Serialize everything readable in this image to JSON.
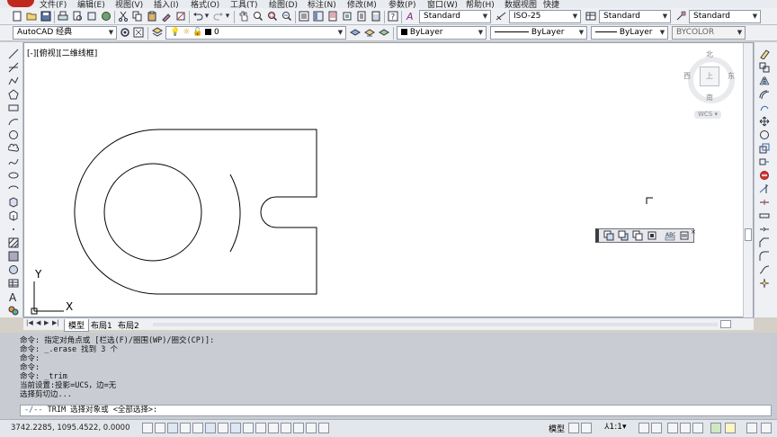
{
  "menu": {
    "items": [
      "文件(F)",
      "编辑(E)",
      "视图(V)",
      "插入(I)",
      "格式(O)",
      "工具(T)",
      "绘图(D)",
      "标注(N)",
      "修改(M)",
      "参数(P)",
      "窗口(W)",
      "帮助(H)",
      "数据视图",
      "快捷"
    ]
  },
  "toolbar": {
    "text_style": "Standard",
    "dim_style": "ISO-25",
    "table_style": "Standard",
    "multileader_style": "Standard",
    "workspace": "AutoCAD 经典",
    "layer": "0",
    "color": "ByLayer",
    "linetype": "ByLayer",
    "lineweight": "ByLayer",
    "plotstyle": "BYCOLOR"
  },
  "viewport": {
    "label": "[-][俯视][二维线框]",
    "viewcube": {
      "north": "北",
      "south": "南",
      "east": "东",
      "west": "西",
      "top": "上",
      "wcs": "WCS"
    },
    "ucs_x": "X",
    "ucs_y": "Y"
  },
  "tabs": {
    "model": "模型",
    "layout1": "布局1",
    "layout2": "布局2"
  },
  "command": {
    "history": [
      "命令: 指定对角点或 [栏选(F)/圈围(WP)/圈交(CP)]:",
      "命令: _.erase 找到 3 个",
      "命令:",
      "命令:",
      "命令: _trim",
      "当前设置:投影=UCS，边=无",
      "选择剪切边..."
    ],
    "prompt": "TRIM 选择对象或 <全部选择>:"
  },
  "status": {
    "coords": "3742.2285, 1095.4522, 0.0000",
    "model_label": "模型",
    "scale": "1:1"
  }
}
